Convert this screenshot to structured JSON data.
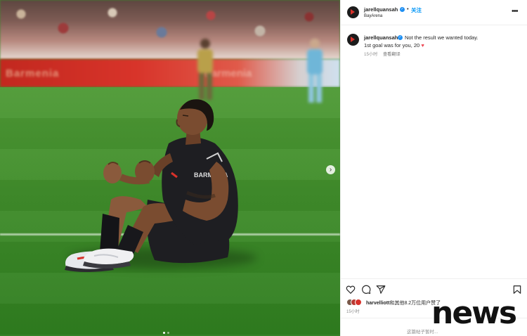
{
  "post": {
    "username": "jarellquansah",
    "follow_label": "关注",
    "separator": "•",
    "location": "BayArena",
    "more_icon": "more-horizontal-icon"
  },
  "media": {
    "ad_text_left": "Barmenia",
    "ad_text_right": "Barmenia",
    "carousel_next_glyph": "›",
    "carousel_dots": 2,
    "carousel_active_index": 0,
    "player_chest_label": "BARMENIA"
  },
  "caption": {
    "username": "jarellquansah",
    "text_line1": "Not the result we wanted today.",
    "text_line2": "1st goal was for you, 20",
    "emoji": "♥",
    "time": "15小时",
    "see_translation": "查看翻译"
  },
  "actions": {
    "like": "heart-icon",
    "comment": "comment-icon",
    "share": "share-icon",
    "save": "bookmark-icon"
  },
  "likes": {
    "user": "harvelliott",
    "text": "和其他8.2万位用户赞了",
    "time": "15小时"
  },
  "footer": {
    "comments_disabled": "这篇帖子暂时..."
  },
  "watermark": {
    "text": "news"
  },
  "colors": {
    "link_blue": "#0095f6",
    "verified_blue": "#1f8ff2",
    "heart_red": "#ed4956",
    "pitch_green": "#3f8c2a",
    "kit_black": "#1e1e22",
    "kit_red": "#d8312a"
  }
}
